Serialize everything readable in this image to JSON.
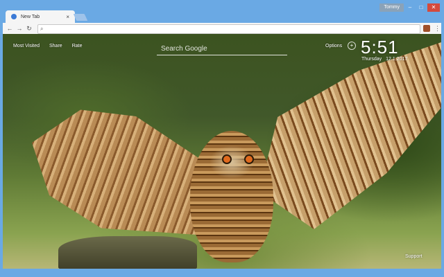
{
  "titlebar": {
    "user_name": "Tommy",
    "minimize": "–",
    "maximize": "□",
    "close": "✕"
  },
  "tab": {
    "title": "New Tab",
    "close": "×"
  },
  "toolbar": {
    "back": "←",
    "forward": "→",
    "reload": "↻",
    "address_value": "",
    "search_glyph": "⌕",
    "menu": "⋮"
  },
  "newtab": {
    "links": [
      "Most Visited",
      "Share",
      "Rate"
    ],
    "search_placeholder": "Search Google",
    "options": "Options",
    "add": "+",
    "time": "5:51",
    "day": "Thursday",
    "date": "12.1.2017",
    "support": "Support"
  },
  "colors": {
    "frame": "#6aa9e4",
    "close_button": "#d44a3c"
  }
}
